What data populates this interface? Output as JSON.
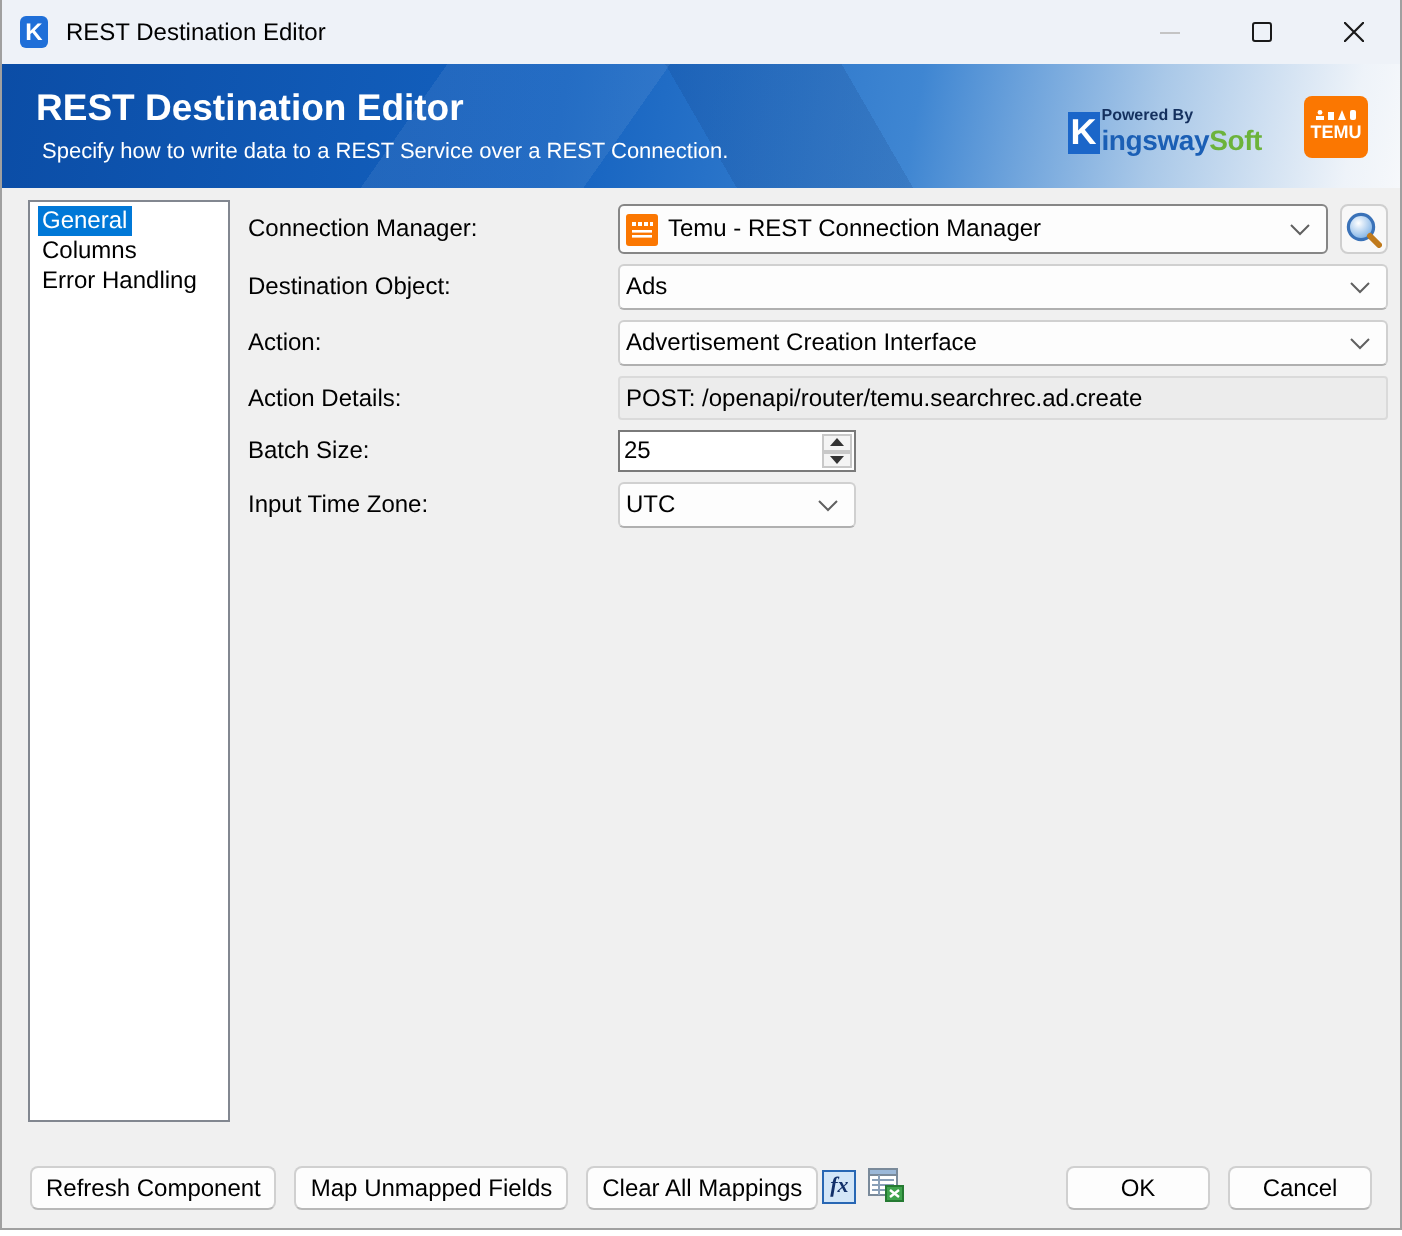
{
  "window": {
    "icon_letter": "K",
    "title": "REST Destination Editor",
    "controls": [
      {
        "kind": "minimize",
        "disabled": true
      },
      {
        "kind": "maximize",
        "disabled": false
      },
      {
        "kind": "close",
        "disabled": false
      }
    ]
  },
  "banner": {
    "title": "REST Destination Editor",
    "subtitle": "Specify how to write data to a REST Service over a REST Connection.",
    "vendor_logo": {
      "tagline": "Powered By",
      "initial": "K",
      "name": "ingsway",
      "suffix": "Soft"
    },
    "service_logo": {
      "text": "TEMU"
    }
  },
  "sidebar": {
    "items": [
      {
        "label": "General",
        "selected": true
      },
      {
        "label": "Columns",
        "selected": false
      },
      {
        "label": "Error Handling",
        "selected": false
      }
    ]
  },
  "form": {
    "fields": [
      {
        "kind": "connection",
        "label": "Connection Manager:",
        "value": "Temu - REST Connection Manager"
      },
      {
        "kind": "dropdown",
        "label": "Destination Object:",
        "value": "Ads"
      },
      {
        "kind": "dropdown",
        "label": "Action:",
        "value": "Advertisement Creation Interface"
      },
      {
        "kind": "readonly",
        "label": "Action Details:",
        "value": "POST: /openapi/router/temu.searchrec.ad.create"
      },
      {
        "kind": "number",
        "label": "Batch Size:",
        "value": "25"
      },
      {
        "kind": "short_dropdown",
        "label": "Input Time Zone:",
        "value": "UTC"
      }
    ]
  },
  "footer": {
    "left_buttons": [
      {
        "kind": "text",
        "label": "Refresh Component"
      },
      {
        "kind": "text",
        "label": "Map Unmapped Fields"
      },
      {
        "kind": "text",
        "label": "Clear All Mappings"
      },
      {
        "kind": "formula",
        "label": "fx"
      },
      {
        "kind": "grid"
      }
    ],
    "right_buttons": [
      {
        "label": "OK"
      },
      {
        "label": "Cancel"
      }
    ]
  }
}
